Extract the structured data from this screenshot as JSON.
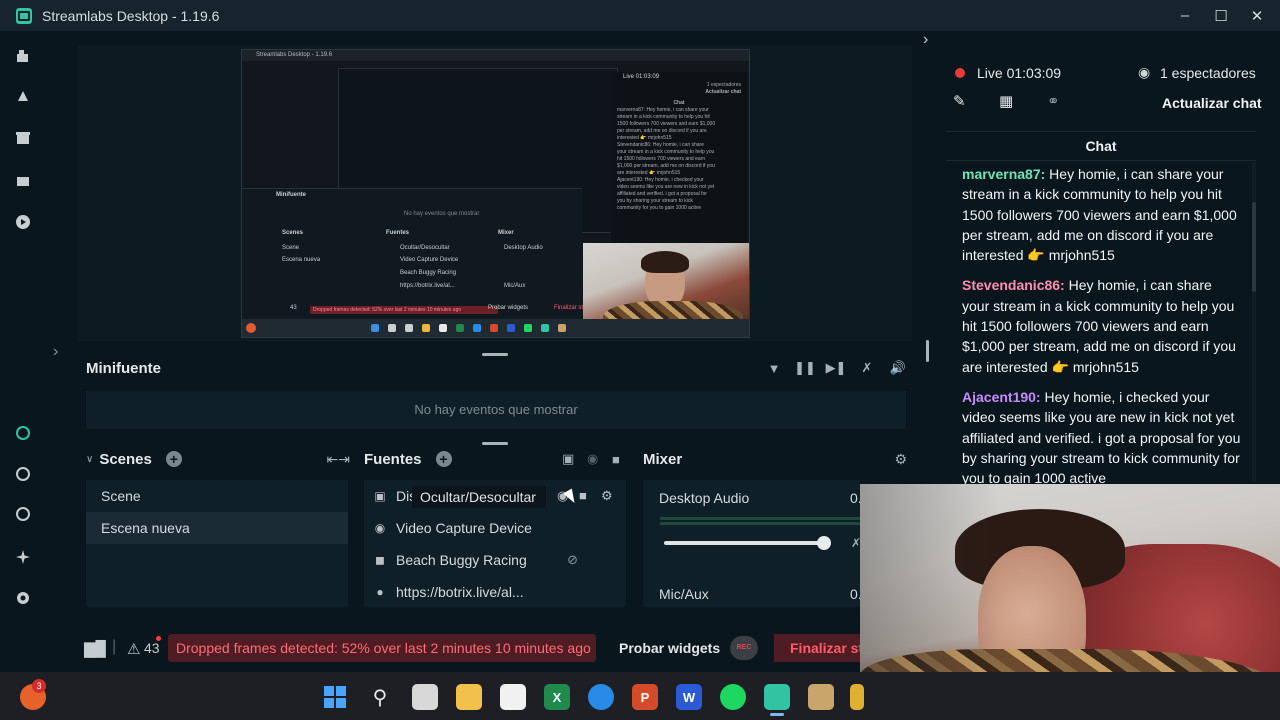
{
  "window": {
    "title": "Streamlabs Desktop - 1.19.6",
    "controls": [
      "minimize",
      "maximize",
      "close"
    ]
  },
  "preview": {
    "inner_title": "Streamlabs Desktop - 1.19.6",
    "inner_minifuente": "Minifuente",
    "inner_no_events": "No hay eventos que mostrar",
    "inner_scenes": "Scenes",
    "inner_fuentes": "Fuentes",
    "inner_mixer": "Mixer",
    "inner_scene_1": "Scene",
    "inner_scene_2": "Escena nueva",
    "inner_src_1": "Ocultar/Desocultar",
    "inner_src_2": "Video Capture Device",
    "inner_src_3": "Beach Buggy Racing",
    "inner_src_4": "https://botrix.live/al...",
    "inner_mix_1": "Desktop Audio",
    "inner_mix_2": "Mic/Aux",
    "inner_live": "Live 01:03:09",
    "inner_viewers": "1 espectadores",
    "inner_refresh": "Actualizar chat",
    "inner_chat": "Chat",
    "inner_chat_lines": [
      "marverna87: Hey homie, i can share your",
      "stream in a kick community to help you hit",
      "1500 followers 700 viewers and earn $1,000",
      "per stream, add me on discord if you are",
      "interested 👉 mrjohn515",
      "Stevendanic86: Hey homie, i can share",
      "your stream in a kick community to help you",
      "hit 1500 followers 700 viewers and earn",
      "$1,000 per stream, add me on discord if you",
      "are interested 👉 mrjohn515",
      "Ajacent190: Hey homie, i checked your",
      "video seems like you are new in kick not yet",
      "affiliated and verified. i got a proposal for",
      "you by sharing your stream to kick",
      "community for you to gain 1000 active"
    ],
    "inner_frames": "43",
    "inner_drop": "Dropped frames detected: 52% over last 2 minutes 10 minutes ago",
    "inner_probar": "Probar widgets",
    "inner_finalize": "Finalizar str"
  },
  "minifuente": {
    "title": "Minifuente",
    "empty_text": "No hay eventos que mostrar"
  },
  "scenes": {
    "title": "Scenes",
    "items": [
      {
        "label": "Scene",
        "active": false
      },
      {
        "label": "Escena nueva",
        "active": true
      }
    ]
  },
  "sources": {
    "title": "Fuentes",
    "items": [
      {
        "label": "Dis",
        "icon": "monitor-icon"
      },
      {
        "label": "Video Capture Device",
        "icon": "webcam-icon"
      },
      {
        "label": "Beach Buggy Racing",
        "icon": "gamepad-icon"
      },
      {
        "label": "https://botrix.live/al...",
        "icon": "globe-icon"
      }
    ],
    "tooltip": "Ocultar/Desocultar"
  },
  "mixer": {
    "title": "Mixer",
    "channels": [
      {
        "label": "Desktop Audio",
        "value": "0.",
        "volume": 1.0
      },
      {
        "label": "Mic/Aux",
        "value": "0."
      }
    ]
  },
  "status": {
    "frames_dropped": "43",
    "warning": "Dropped frames detected: 52% over last 2 minutes 10 minutes ago",
    "test_widgets": "Probar widgets",
    "rec_label": "REC",
    "end_stream": "Finalizar st"
  },
  "live": {
    "status": "Live 01:03:09",
    "viewers": "1 espectadores",
    "refresh_chat": "Actualizar chat",
    "chat_title": "Chat"
  },
  "chat": {
    "messages": [
      {
        "user": "marverna87",
        "color": "#6fe6b5",
        "text": " Hey homie, i can share your stream in a kick community to help you hit 1500 followers 700 viewers and earn $1,000 per stream, add me on discord if you are interested 👉 mrjohn515"
      },
      {
        "user": "Stevendanic86",
        "color": "#ff8fb0",
        "text": " Hey homie, i can share your stream in a kick community to help you hit 1500 followers 700 viewers and earn $1,000 per stream, add me on discord if you are interested 👉 mrjohn515"
      },
      {
        "user": "Ajacent190",
        "color": "#c58cff",
        "text": " Hey homie, i checked your video seems like you are new in kick not yet affiliated and verified. i got a proposal for you by sharing your stream to kick community for you to gain 1000 active"
      }
    ]
  },
  "taskbar": {
    "notification_count": "3",
    "apps": [
      "brave-icon",
      "windows-start-icon",
      "search-icon",
      "task-view-icon",
      "file-explorer-icon",
      "microsoft-store-icon",
      "excel-icon",
      "edge-icon",
      "powerpoint-icon",
      "word-icon",
      "spotify-icon",
      "streamlabs-icon",
      "game-icon",
      "tray-icon"
    ]
  },
  "colors": {
    "accent": "#31c3a2",
    "live_red": "#e63b3b",
    "warning_bg": "#4f1c24",
    "warning_text": "#ff6b78"
  }
}
